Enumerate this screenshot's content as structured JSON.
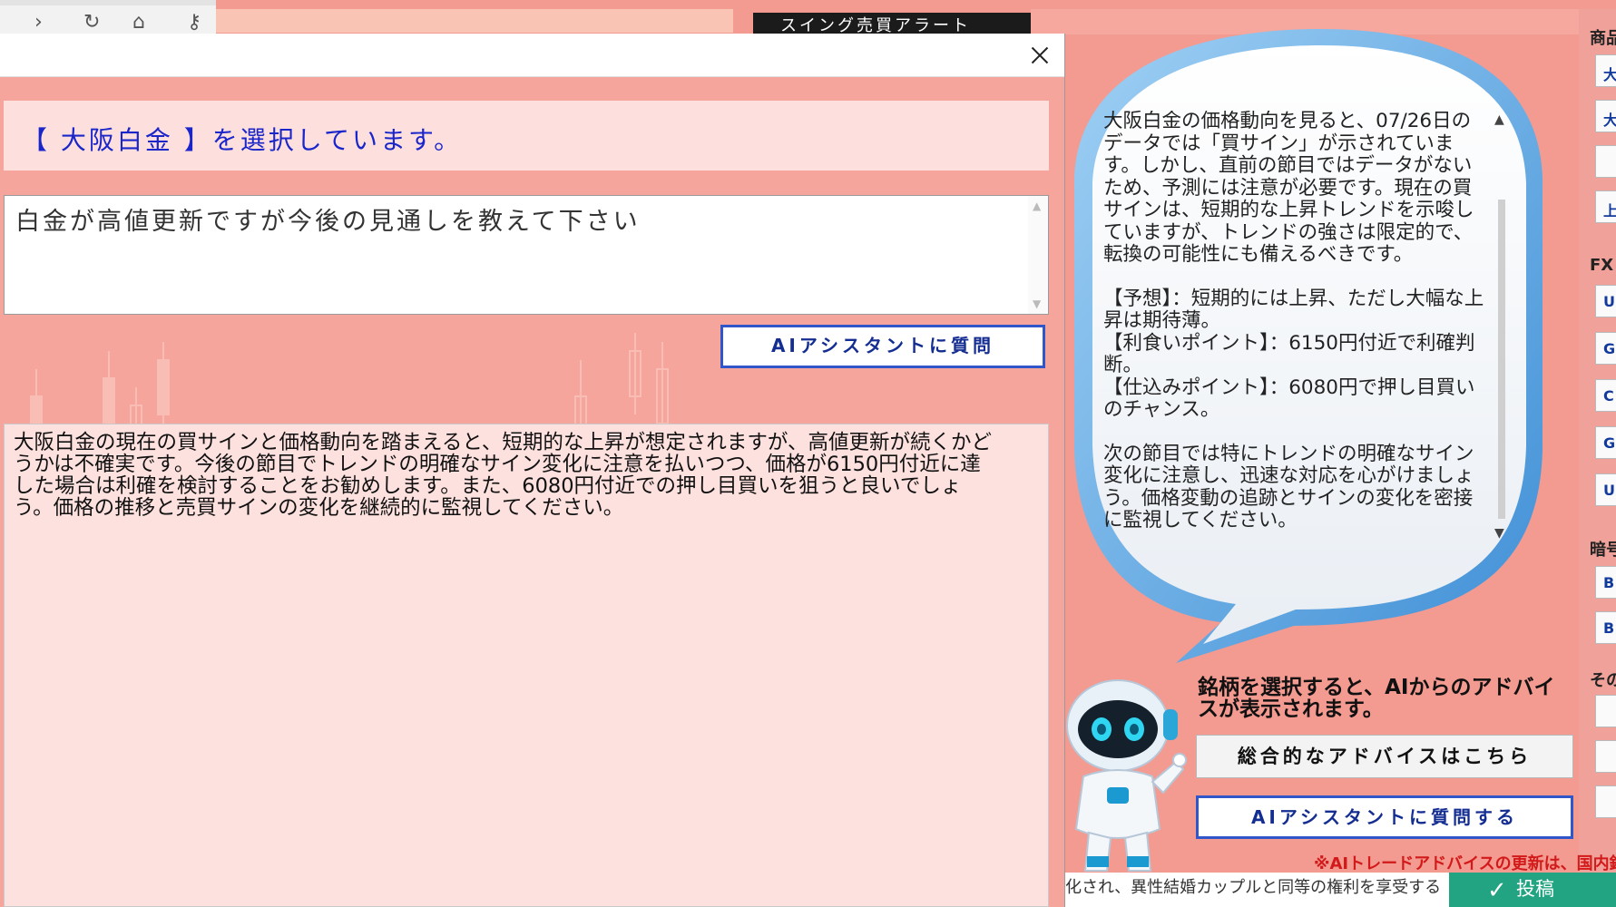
{
  "background_app": {
    "title_bar_text": "スイング売買アラート",
    "sidebar_headers": [
      "商品",
      "FX",
      "暗号",
      "その"
    ],
    "sidebar_buttons": [
      "大",
      "大",
      "",
      "上",
      "U",
      "G",
      "C",
      "G",
      "U",
      "B",
      "B",
      "",
      "",
      ""
    ]
  },
  "dialog": {
    "selection_banner": "【 大阪白金 】を選択しています。",
    "question_text": "白金が高値更新ですが今後の見通しを教えて下さい",
    "ask_button_label": "AIアシスタントに質問",
    "answer_text": "大阪白金の現在の買サインと価格動向を踏まえると、短期的な上昇が想定されますが、高値更新が続くかどうかは不確実です。今後の節目でトレンドの明確なサイン変化に注意を払いつつ、価格が6150円付近に達した場合は利確を検討することをお勧めします。また、6080円付近での押し目買いを狙うと良いでしょう。価格の推移と売買サインの変化を継続的に監視してください。"
  },
  "bubble": {
    "paragraphs": [
      "大阪白金の価格動向を見ると、07/26日のデータでは「買サイン」が示されています。しかし、直前の節目ではデータがないため、予測には注意が必要です。現在の買サインは、短期的な上昇トレンドを示唆していますが、トレンドの強さは限定的で、転換の可能性にも備えるべきです。",
      "【予想】：短期的には上昇、ただし大幅な上昇は期待薄。\n【利食いポイント】：6150円付近で利確判断。\n【仕込みポイント】：6080円で押し目買いのチャンス。",
      "次の節目では特にトレンドの明確なサイン変化に注意し、迅速な対応を心がけましょう。価格変動の追跡とサインの変化を密接に監視してください。"
    ]
  },
  "advice_panel": {
    "label": "銘柄を選択すると、AIからのアドバイスが表示されます。",
    "overall_button": "総合的なアドバイスはこちら",
    "assistant_button": "AIアシスタントに質問する",
    "notice": "※AIトレードアドバイスの更新は、国内銘柄"
  },
  "webpage": {
    "bottom_text": "化され、異性結婚カップルと同等の権利を享受する",
    "post_button": "投稿"
  },
  "colors": {
    "accent_blue": "#3156c9",
    "banner_text": "#1a26c9",
    "dialog_bg": "#f6a59c",
    "post_green": "#22a381",
    "notice_red": "#d21a1a"
  }
}
